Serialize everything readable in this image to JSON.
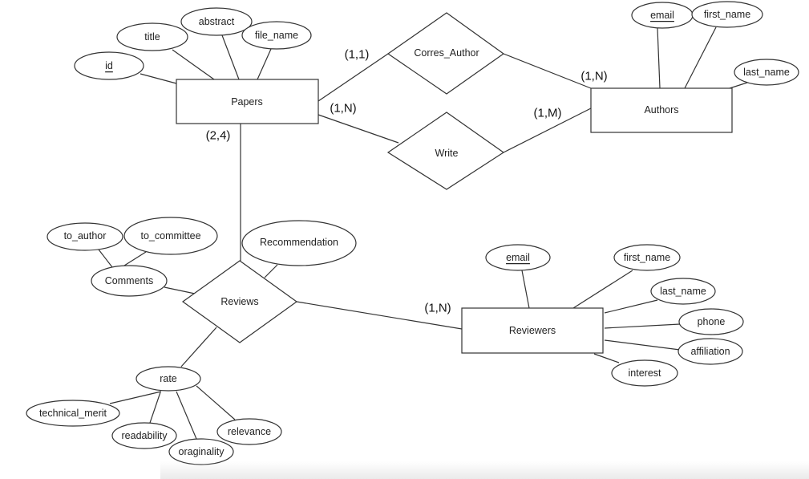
{
  "entities": {
    "papers": "Papers",
    "authors": "Authors",
    "reviewers": "Reviewers"
  },
  "relationships": {
    "corres_author": "Corres_Author",
    "write": "Write",
    "reviews": "Reviews"
  },
  "attributes": {
    "papers": {
      "id": "id",
      "title": "title",
      "abstract": "abstract",
      "file_name": "file_name"
    },
    "authors": {
      "email": "email",
      "first_name": "first_name",
      "last_name": "last_name"
    },
    "reviewers": {
      "email": "email",
      "first_name": "first_name",
      "last_name": "last_name",
      "phone": "phone",
      "affiliation": "affiliation",
      "interest": "interest"
    },
    "reviews": {
      "comments": "Comments",
      "to_author": "to_author",
      "to_committee": "to_committee",
      "recommendation": "Recommendation",
      "rate": "rate",
      "technical_merit": "technical_merit",
      "readability": "readability",
      "oraginality": "oraginality",
      "relevance": "relevance"
    }
  },
  "key_attributes": [
    "papers.id",
    "authors.email",
    "reviewers.email"
  ],
  "cardinalities": {
    "papers_corres_author": "(1,1)",
    "papers_write": "(1,N)",
    "authors_corres_author": "(1,N)",
    "authors_write": "(1,M)",
    "papers_reviews": "(2,4)",
    "reviewers_reviews": "(1,N)"
  }
}
